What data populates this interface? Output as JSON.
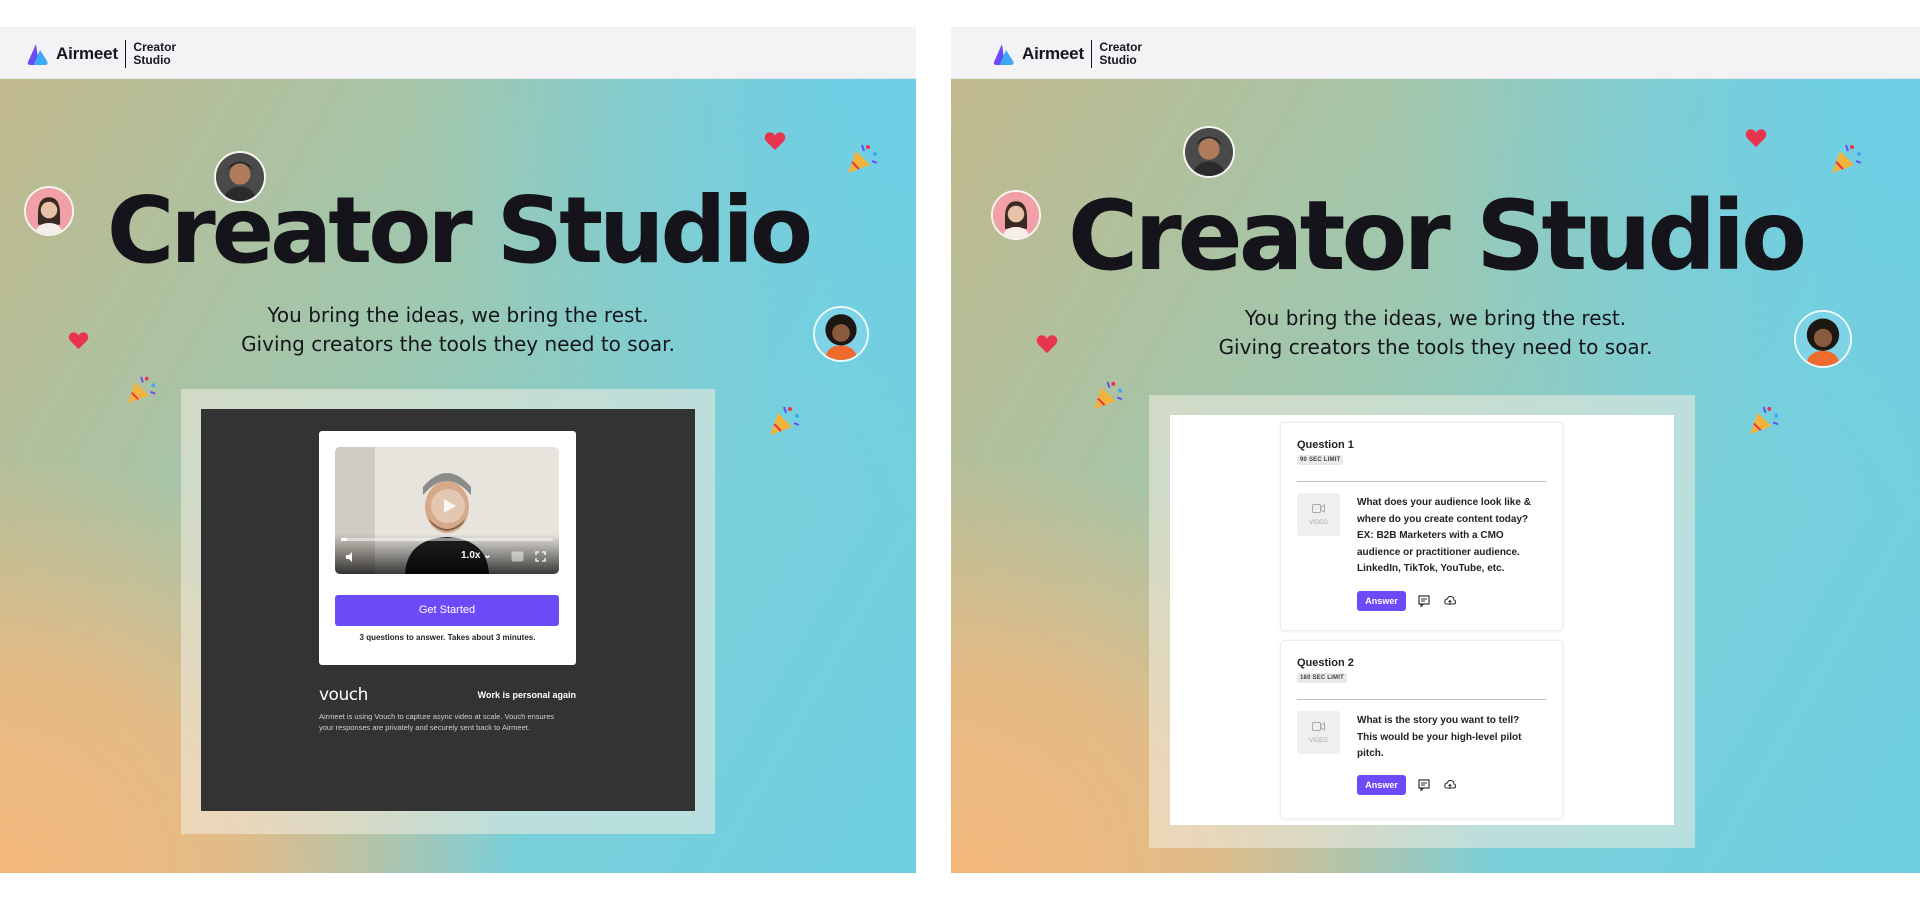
{
  "brand": {
    "name": "Airmeet",
    "sub_line1": "Creator",
    "sub_line2": "Studio"
  },
  "hero": {
    "title": "Creator Studio",
    "subtitle_line1": "You bring the ideas, we bring the rest.",
    "subtitle_line2": "Giving creators the tools they need to soar."
  },
  "left_panel": {
    "video": {
      "speed": "1.0x",
      "progress": 0.03
    },
    "get_started_label": "Get Started",
    "note": "3 questions to answer. Takes about 3 minutes.",
    "vouch_logo": "vouch",
    "vouch_tagline": "Work is personal again",
    "vouch_desc_line1": "Airmeet is using Vouch to capture async video at scale. Vouch ensures",
    "vouch_desc_line2": "your responses are privately and securely sent back to Airmeet."
  },
  "right_panel": {
    "questions": [
      {
        "title": "Question 1",
        "limit": "90 SEC LIMIT",
        "thumb_label": "VIDEO",
        "text_lines": [
          "What does your audience look like &",
          "where do you create content today?",
          "EX: B2B Marketers with a CMO",
          "audience or practitioner audience.",
          "LinkedIn, TikTok, YouTube, etc."
        ],
        "answer_label": "Answer"
      },
      {
        "title": "Question 2",
        "limit": "180 SEC LIMIT",
        "thumb_label": "VIDEO",
        "text_lines": [
          "What is the story you want to tell?",
          "This would be your high-level pilot",
          "pitch."
        ],
        "answer_label": "Answer"
      }
    ]
  },
  "colors": {
    "accent": "#6a4bf7",
    "dark_panel": "#333333",
    "heart": "#e8344e"
  },
  "icons": [
    "airmeet-logo-icon",
    "heart-icon",
    "party-popper-icon",
    "volume-icon",
    "settings-icon",
    "fullscreen-icon",
    "play-icon",
    "camera-icon",
    "comment-icon",
    "upload-icon"
  ]
}
